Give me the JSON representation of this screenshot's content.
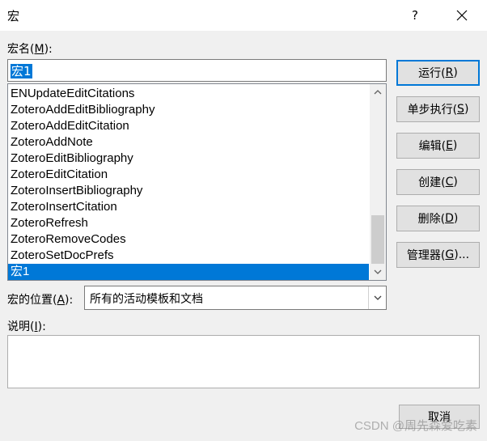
{
  "window": {
    "title": "宏",
    "help": "?",
    "close_icon": "close-icon"
  },
  "macro_name": {
    "label": "宏名(",
    "accel": "M",
    "label_end": "):",
    "value": "宏1"
  },
  "macro_list": {
    "items": [
      "ENUpdateEditCitations",
      "ZoteroAddEditBibliography",
      "ZoteroAddEditCitation",
      "ZoteroAddNote",
      "ZoteroEditBibliography",
      "ZoteroEditCitation",
      "ZoteroInsertBibliography",
      "ZoteroInsertCitation",
      "ZoteroRefresh",
      "ZoteroRemoveCodes",
      "ZoteroSetDocPrefs",
      "宏1"
    ],
    "selected": "宏1"
  },
  "buttons": {
    "run": {
      "pre": "运行(",
      "accel": "R",
      "post": ")"
    },
    "step": {
      "pre": "单步执行(",
      "accel": "S",
      "post": ")"
    },
    "edit": {
      "pre": "编辑(",
      "accel": "E",
      "post": ")"
    },
    "create": {
      "pre": "创建(",
      "accel": "C",
      "post": ")"
    },
    "delete": {
      "pre": "删除(",
      "accel": "D",
      "post": ")"
    },
    "organizer": {
      "pre": "管理器(",
      "accel": "G",
      "post": ")..."
    },
    "cancel": "取消"
  },
  "macros_in": {
    "label": "宏的位置(",
    "accel": "A",
    "label_end": "):",
    "value": "所有的活动模板和文档"
  },
  "description": {
    "label": "说明(",
    "accel": "I",
    "label_end": "):"
  },
  "watermark": "CSDN @周先森爱吃素"
}
